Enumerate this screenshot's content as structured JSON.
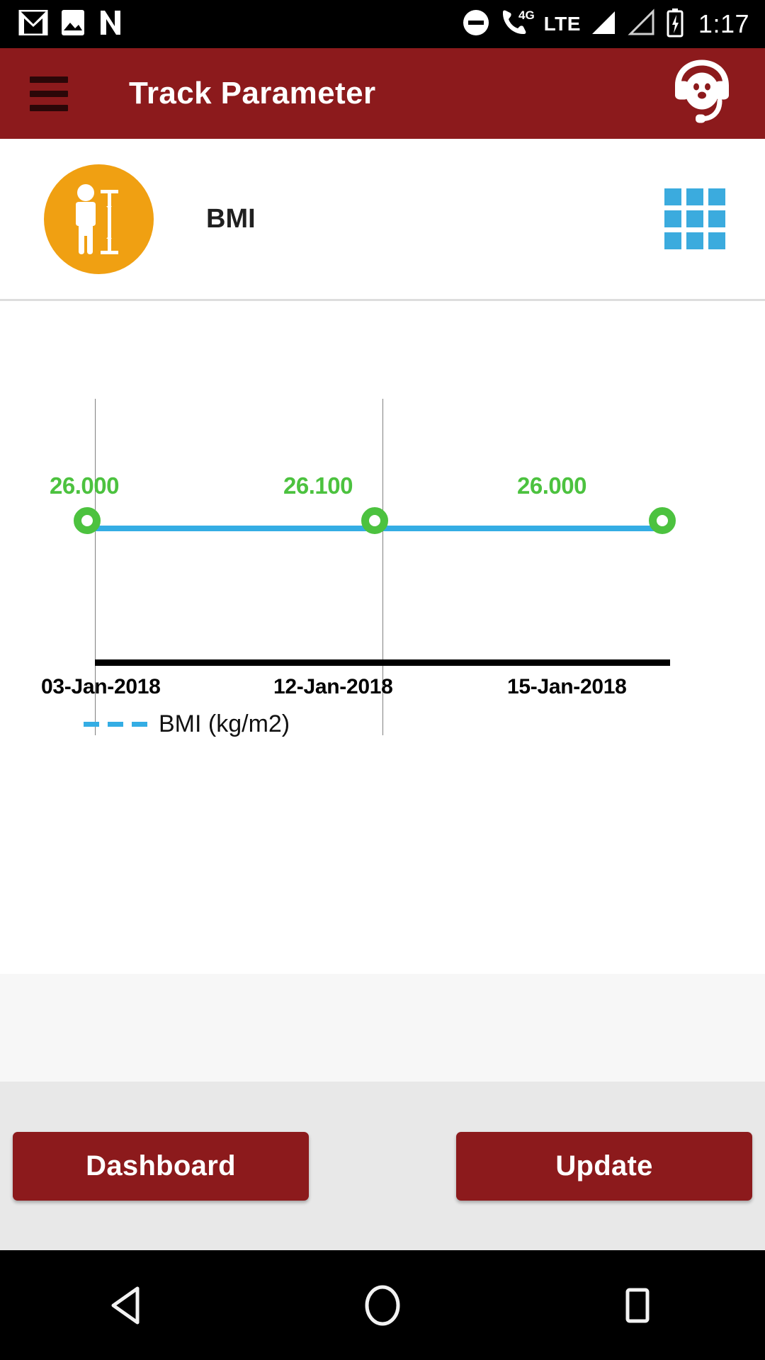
{
  "status_bar": {
    "icons_left": [
      "gmail-icon",
      "photos-icon",
      "netflix-icon"
    ],
    "icons_right": [
      "do-not-disturb-icon",
      "phone-4g-icon",
      "signal-icon-1",
      "signal-icon-2",
      "battery-icon"
    ],
    "network_label": "LTE",
    "network_badge": "4G",
    "time": "1:17"
  },
  "app_bar": {
    "title": "Track Parameter",
    "menu_icon": "hamburger-icon",
    "support_icon": "headset-support-icon",
    "background_color": "#8C1A1C"
  },
  "parameter_header": {
    "label": "BMI",
    "avatar_icon": "body-height-measure-icon",
    "avatar_color": "#F0A012",
    "grid_icon": "grid-view-icon",
    "grid_color": "#3BABDE"
  },
  "chart_data": {
    "type": "line",
    "title": "",
    "xlabel": "",
    "ylabel": "",
    "categories": [
      "03-Jan-2018",
      "12-Jan-2018",
      "15-Jan-2018"
    ],
    "values": [
      26.0,
      26.1,
      26.0
    ],
    "point_labels": [
      "26.000",
      "26.100",
      "26.000"
    ],
    "series": [
      {
        "name": "BMI (kg/m2)",
        "values": [
          26.0,
          26.1,
          26.0
        ]
      }
    ],
    "legend": [
      {
        "label": "BMI (kg/m2)",
        "color": "#34ADE4",
        "style": "dashed"
      }
    ],
    "legend_position": "bottom-left",
    "grid": true,
    "line_color": "#34ADE4",
    "marker_color": "#4CC23F",
    "label_color": "#4CC23F",
    "axis_color": "#000000"
  },
  "footer": {
    "dashboard_label": "Dashboard",
    "update_label": "Update",
    "button_color": "#8C1A1C"
  },
  "nav_bar": {
    "back_icon": "back-triangle-icon",
    "home_icon": "home-circle-icon",
    "recents_icon": "recents-square-icon"
  }
}
